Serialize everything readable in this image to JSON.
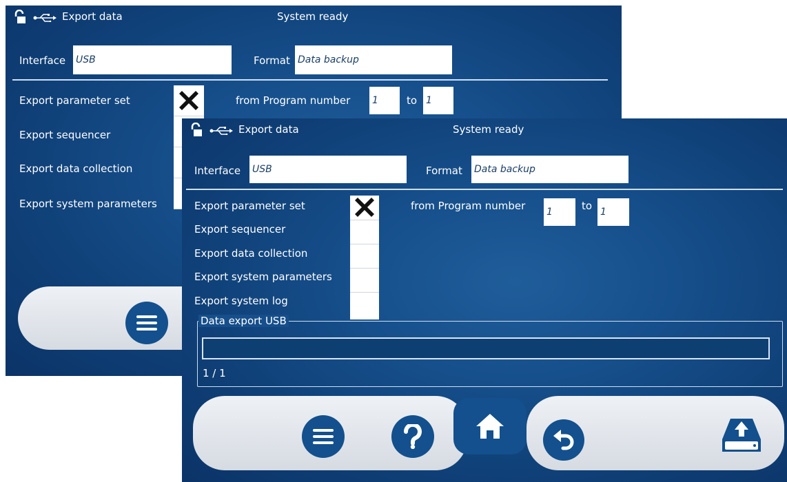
{
  "back_screen": {
    "title": "Export data",
    "status": "System ready",
    "interface_label": "Interface",
    "interface_value": "USB",
    "format_label": "Format",
    "format_value": "Data backup",
    "export_items": [
      "Export parameter set",
      "Export sequencer",
      "Export data collection",
      "Export system parameters"
    ],
    "from_program_label": "from Program number",
    "from_value": "1",
    "to_label": "to",
    "to_value": "1",
    "icons": [
      "unlock-icon",
      "usb-icon",
      "checkbox-x-icon",
      "menu-icon"
    ]
  },
  "front_screen": {
    "title": "Export data",
    "status": "System ready",
    "interface_label": "Interface",
    "interface_value": "USB",
    "format_label": "Format",
    "format_value": "Data backup",
    "export_items": [
      "Export parameter set",
      "Export sequencer",
      "Export data collection",
      "Export system parameters",
      "Export system log"
    ],
    "checked": [
      true,
      false,
      false,
      false,
      false
    ],
    "from_program_label": "from Program number",
    "from_value": "1",
    "to_label": "to",
    "to_value": "1",
    "group_title": "Data export USB",
    "progress_fraction": 0,
    "progress_text": "1 / 1",
    "icons": [
      "unlock-icon",
      "usb-icon",
      "menu-icon",
      "help-icon",
      "home-icon",
      "undo-icon",
      "export-upload-icon"
    ]
  },
  "colors": {
    "screen_bg": "#164f8b",
    "button_blue": "#13508d",
    "pill_gray": "#e4e8ed"
  }
}
